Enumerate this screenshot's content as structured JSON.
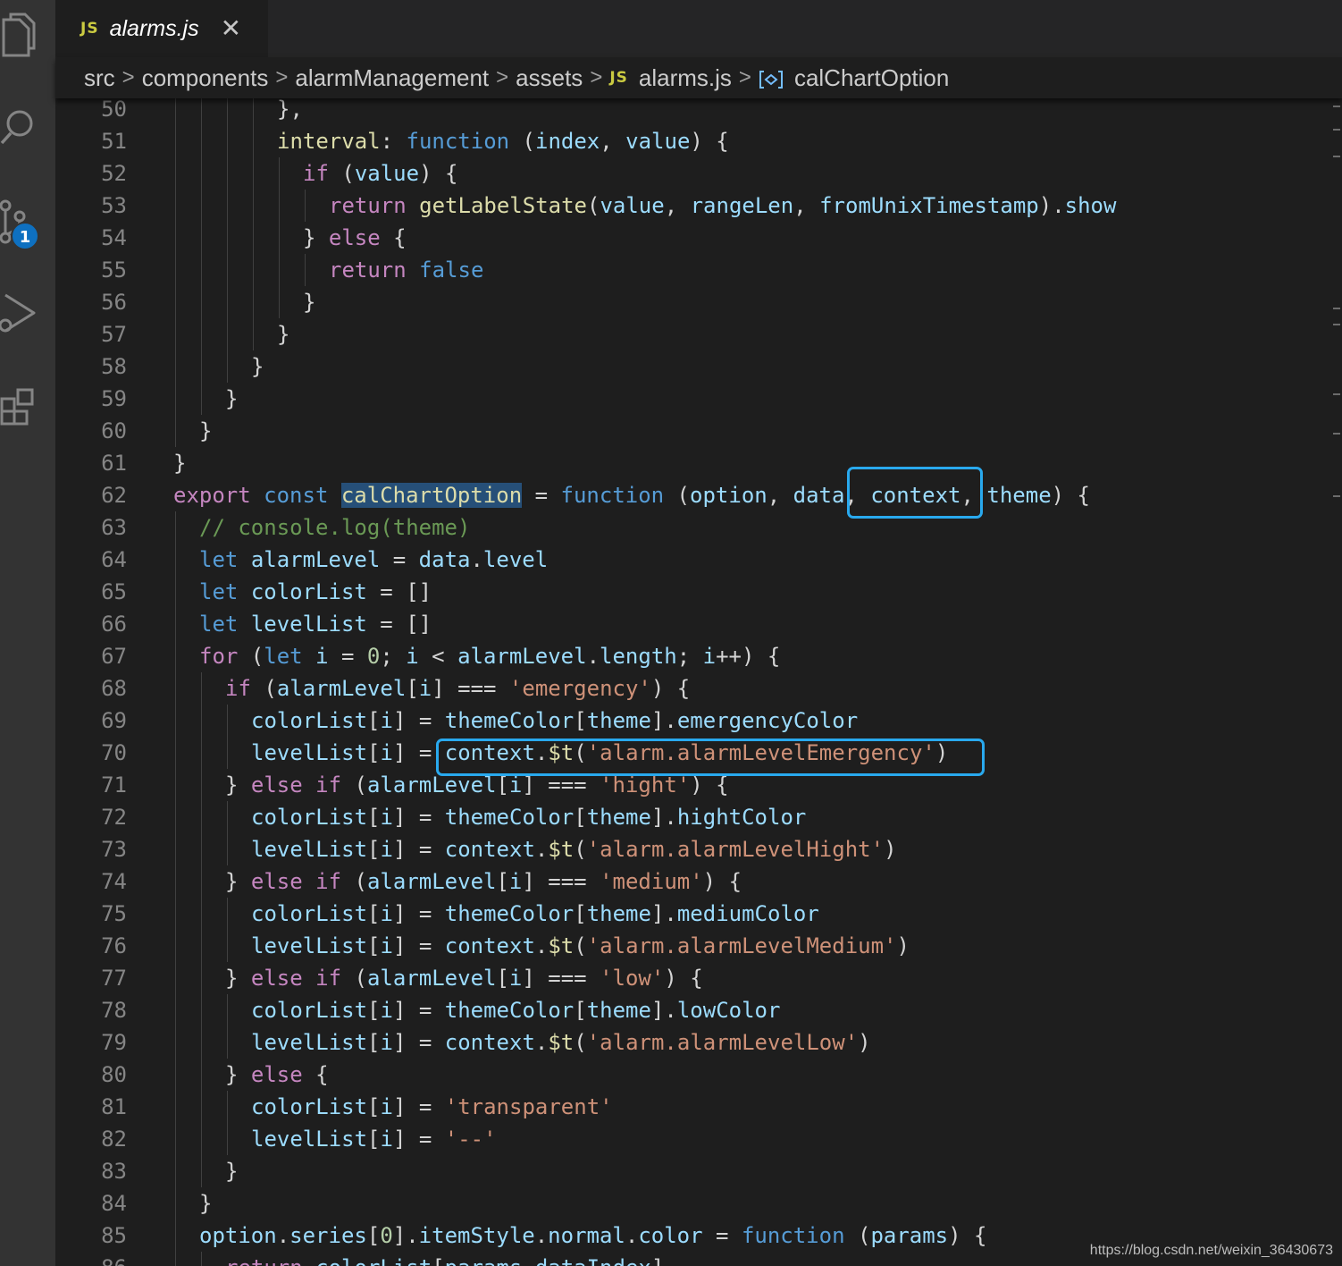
{
  "tab": {
    "lang_badge": "JS",
    "filename": "alarms.js",
    "close_glyph": "✕"
  },
  "activity_bar": {
    "icons": [
      "files-icon",
      "search-icon",
      "source-control-icon",
      "run-debug-icon",
      "extensions-icon"
    ],
    "source_control_badge": "1"
  },
  "breadcrumb": {
    "items": [
      "src",
      "components",
      "alarmManagement",
      "assets",
      "alarms.js",
      "calChartOption"
    ],
    "separator": ">",
    "file_badge": "JS"
  },
  "colors": {
    "keyword": "#c586c0",
    "storage": "#569cd6",
    "variable": "#9cdcfe",
    "function": "#dcdcaa",
    "string": "#ce9178",
    "number": "#b5cea8",
    "comment": "#6a9955",
    "highlight_box": "#29a9ee"
  },
  "code": {
    "lines": [
      {
        "n": "50",
        "indent": 4,
        "tokens": [
          [
            "p",
            "},"
          ]
        ]
      },
      {
        "n": "51",
        "indent": 4,
        "tokens": [
          [
            "f",
            "interval"
          ],
          [
            "p",
            ": "
          ],
          [
            "s",
            "function"
          ],
          [
            "p",
            " ("
          ],
          [
            "v",
            "index"
          ],
          [
            "p",
            ", "
          ],
          [
            "v",
            "value"
          ],
          [
            "p",
            ") {"
          ]
        ]
      },
      {
        "n": "52",
        "indent": 5,
        "tokens": [
          [
            "k",
            "if"
          ],
          [
            "p",
            " ("
          ],
          [
            "v",
            "value"
          ],
          [
            "p",
            ") {"
          ]
        ]
      },
      {
        "n": "53",
        "indent": 6,
        "tokens": [
          [
            "k",
            "return"
          ],
          [
            "p",
            " "
          ],
          [
            "f",
            "getLabelState"
          ],
          [
            "p",
            "("
          ],
          [
            "v",
            "value"
          ],
          [
            "p",
            ", "
          ],
          [
            "v",
            "rangeLen"
          ],
          [
            "p",
            ", "
          ],
          [
            "v",
            "fromUnixTimestamp"
          ],
          [
            "p",
            ")."
          ],
          [
            "v",
            "show"
          ]
        ]
      },
      {
        "n": "54",
        "indent": 5,
        "tokens": [
          [
            "p",
            "} "
          ],
          [
            "k",
            "else"
          ],
          [
            "p",
            " {"
          ]
        ]
      },
      {
        "n": "55",
        "indent": 6,
        "tokens": [
          [
            "k",
            "return"
          ],
          [
            "p",
            " "
          ],
          [
            "s",
            "false"
          ]
        ]
      },
      {
        "n": "56",
        "indent": 5,
        "tokens": [
          [
            "p",
            "}"
          ]
        ]
      },
      {
        "n": "57",
        "indent": 4,
        "tokens": [
          [
            "p",
            "}"
          ]
        ]
      },
      {
        "n": "58",
        "indent": 3,
        "tokens": [
          [
            "p",
            "}"
          ]
        ]
      },
      {
        "n": "59",
        "indent": 2,
        "tokens": [
          [
            "p",
            "}"
          ]
        ]
      },
      {
        "n": "60",
        "indent": 1,
        "tokens": [
          [
            "p",
            "}"
          ]
        ]
      },
      {
        "n": "61",
        "indent": 0,
        "tokens": [
          [
            "p",
            "}"
          ]
        ]
      },
      {
        "n": "62",
        "indent": 0,
        "tokens": [
          [
            "k",
            "export"
          ],
          [
            "p",
            " "
          ],
          [
            "s",
            "const"
          ],
          [
            "p",
            " "
          ],
          [
            "f hl",
            "calChartOption"
          ],
          [
            "p",
            " = "
          ],
          [
            "s",
            "function"
          ],
          [
            "p",
            " ("
          ],
          [
            "v",
            "option"
          ],
          [
            "p",
            ", "
          ],
          [
            "v",
            "data"
          ],
          [
            "p",
            ", "
          ],
          [
            "v",
            "context"
          ],
          [
            "p",
            ", "
          ],
          [
            "v",
            "theme"
          ],
          [
            "p",
            ") {"
          ]
        ]
      },
      {
        "n": "63",
        "indent": 1,
        "tokens": [
          [
            "c",
            "// console.log(theme)"
          ]
        ]
      },
      {
        "n": "64",
        "indent": 1,
        "tokens": [
          [
            "s",
            "let"
          ],
          [
            "p",
            " "
          ],
          [
            "v",
            "alarmLevel"
          ],
          [
            "p",
            " = "
          ],
          [
            "v",
            "data"
          ],
          [
            "p",
            "."
          ],
          [
            "v",
            "level"
          ]
        ]
      },
      {
        "n": "65",
        "indent": 1,
        "tokens": [
          [
            "s",
            "let"
          ],
          [
            "p",
            " "
          ],
          [
            "v",
            "colorList"
          ],
          [
            "p",
            " = []"
          ]
        ]
      },
      {
        "n": "66",
        "indent": 1,
        "tokens": [
          [
            "s",
            "let"
          ],
          [
            "p",
            " "
          ],
          [
            "v",
            "levelList"
          ],
          [
            "p",
            " = []"
          ]
        ]
      },
      {
        "n": "67",
        "indent": 1,
        "tokens": [
          [
            "k",
            "for"
          ],
          [
            "p",
            " ("
          ],
          [
            "s",
            "let"
          ],
          [
            "p",
            " "
          ],
          [
            "v",
            "i"
          ],
          [
            "p",
            " = "
          ],
          [
            "n",
            "0"
          ],
          [
            "p",
            "; "
          ],
          [
            "v",
            "i"
          ],
          [
            "p",
            " < "
          ],
          [
            "v",
            "alarmLevel"
          ],
          [
            "p",
            "."
          ],
          [
            "v",
            "length"
          ],
          [
            "p",
            "; "
          ],
          [
            "v",
            "i"
          ],
          [
            "p",
            "++) {"
          ]
        ]
      },
      {
        "n": "68",
        "indent": 2,
        "tokens": [
          [
            "k",
            "if"
          ],
          [
            "p",
            " ("
          ],
          [
            "v",
            "alarmLevel"
          ],
          [
            "p",
            "["
          ],
          [
            "v",
            "i"
          ],
          [
            "p",
            "] === "
          ],
          [
            "st",
            "'emergency'"
          ],
          [
            "p",
            ") {"
          ]
        ]
      },
      {
        "n": "69",
        "indent": 3,
        "tokens": [
          [
            "v",
            "colorList"
          ],
          [
            "p",
            "["
          ],
          [
            "v",
            "i"
          ],
          [
            "p",
            "] = "
          ],
          [
            "v",
            "themeColor"
          ],
          [
            "p",
            "["
          ],
          [
            "v",
            "theme"
          ],
          [
            "p",
            "]."
          ],
          [
            "v",
            "emergencyColor"
          ]
        ]
      },
      {
        "n": "70",
        "indent": 3,
        "tokens": [
          [
            "v",
            "levelList"
          ],
          [
            "p",
            "["
          ],
          [
            "v",
            "i"
          ],
          [
            "p",
            "] = "
          ],
          [
            "v",
            "context"
          ],
          [
            "p",
            "."
          ],
          [
            "f",
            "$t"
          ],
          [
            "p",
            "("
          ],
          [
            "st",
            "'alarm.alarmLevelEmergency'"
          ],
          [
            "p",
            ")"
          ]
        ]
      },
      {
        "n": "71",
        "indent": 2,
        "tokens": [
          [
            "p",
            "} "
          ],
          [
            "k",
            "else"
          ],
          [
            "p",
            " "
          ],
          [
            "k",
            "if"
          ],
          [
            "p",
            " ("
          ],
          [
            "v",
            "alarmLevel"
          ],
          [
            "p",
            "["
          ],
          [
            "v",
            "i"
          ],
          [
            "p",
            "] === "
          ],
          [
            "st",
            "'hight'"
          ],
          [
            "p",
            ") {"
          ]
        ]
      },
      {
        "n": "72",
        "indent": 3,
        "tokens": [
          [
            "v",
            "colorList"
          ],
          [
            "p",
            "["
          ],
          [
            "v",
            "i"
          ],
          [
            "p",
            "] = "
          ],
          [
            "v",
            "themeColor"
          ],
          [
            "p",
            "["
          ],
          [
            "v",
            "theme"
          ],
          [
            "p",
            "]."
          ],
          [
            "v",
            "hightColor"
          ]
        ]
      },
      {
        "n": "73",
        "indent": 3,
        "tokens": [
          [
            "v",
            "levelList"
          ],
          [
            "p",
            "["
          ],
          [
            "v",
            "i"
          ],
          [
            "p",
            "] = "
          ],
          [
            "v",
            "context"
          ],
          [
            "p",
            "."
          ],
          [
            "f",
            "$t"
          ],
          [
            "p",
            "("
          ],
          [
            "st",
            "'alarm.alarmLevelHight'"
          ],
          [
            "p",
            ")"
          ]
        ]
      },
      {
        "n": "74",
        "indent": 2,
        "tokens": [
          [
            "p",
            "} "
          ],
          [
            "k",
            "else"
          ],
          [
            "p",
            " "
          ],
          [
            "k",
            "if"
          ],
          [
            "p",
            " ("
          ],
          [
            "v",
            "alarmLevel"
          ],
          [
            "p",
            "["
          ],
          [
            "v",
            "i"
          ],
          [
            "p",
            "] === "
          ],
          [
            "st",
            "'medium'"
          ],
          [
            "p",
            ") {"
          ]
        ]
      },
      {
        "n": "75",
        "indent": 3,
        "tokens": [
          [
            "v",
            "colorList"
          ],
          [
            "p",
            "["
          ],
          [
            "v",
            "i"
          ],
          [
            "p",
            "] = "
          ],
          [
            "v",
            "themeColor"
          ],
          [
            "p",
            "["
          ],
          [
            "v",
            "theme"
          ],
          [
            "p",
            "]."
          ],
          [
            "v",
            "mediumColor"
          ]
        ]
      },
      {
        "n": "76",
        "indent": 3,
        "tokens": [
          [
            "v",
            "levelList"
          ],
          [
            "p",
            "["
          ],
          [
            "v",
            "i"
          ],
          [
            "p",
            "] = "
          ],
          [
            "v",
            "context"
          ],
          [
            "p",
            "."
          ],
          [
            "f",
            "$t"
          ],
          [
            "p",
            "("
          ],
          [
            "st",
            "'alarm.alarmLevelMedium'"
          ],
          [
            "p",
            ")"
          ]
        ]
      },
      {
        "n": "77",
        "indent": 2,
        "tokens": [
          [
            "p",
            "} "
          ],
          [
            "k",
            "else"
          ],
          [
            "p",
            " "
          ],
          [
            "k",
            "if"
          ],
          [
            "p",
            " ("
          ],
          [
            "v",
            "alarmLevel"
          ],
          [
            "p",
            "["
          ],
          [
            "v",
            "i"
          ],
          [
            "p",
            "] === "
          ],
          [
            "st",
            "'low'"
          ],
          [
            "p",
            ") {"
          ]
        ]
      },
      {
        "n": "78",
        "indent": 3,
        "tokens": [
          [
            "v",
            "colorList"
          ],
          [
            "p",
            "["
          ],
          [
            "v",
            "i"
          ],
          [
            "p",
            "] = "
          ],
          [
            "v",
            "themeColor"
          ],
          [
            "p",
            "["
          ],
          [
            "v",
            "theme"
          ],
          [
            "p",
            "]."
          ],
          [
            "v",
            "lowColor"
          ]
        ]
      },
      {
        "n": "79",
        "indent": 3,
        "tokens": [
          [
            "v",
            "levelList"
          ],
          [
            "p",
            "["
          ],
          [
            "v",
            "i"
          ],
          [
            "p",
            "] = "
          ],
          [
            "v",
            "context"
          ],
          [
            "p",
            "."
          ],
          [
            "f",
            "$t"
          ],
          [
            "p",
            "("
          ],
          [
            "st",
            "'alarm.alarmLevelLow'"
          ],
          [
            "p",
            ")"
          ]
        ]
      },
      {
        "n": "80",
        "indent": 2,
        "tokens": [
          [
            "p",
            "} "
          ],
          [
            "k",
            "else"
          ],
          [
            "p",
            " {"
          ]
        ]
      },
      {
        "n": "81",
        "indent": 3,
        "tokens": [
          [
            "v",
            "colorList"
          ],
          [
            "p",
            "["
          ],
          [
            "v",
            "i"
          ],
          [
            "p",
            "] = "
          ],
          [
            "st",
            "'transparent'"
          ]
        ]
      },
      {
        "n": "82",
        "indent": 3,
        "tokens": [
          [
            "v",
            "levelList"
          ],
          [
            "p",
            "["
          ],
          [
            "v",
            "i"
          ],
          [
            "p",
            "] = "
          ],
          [
            "st",
            "'--'"
          ]
        ]
      },
      {
        "n": "83",
        "indent": 2,
        "tokens": [
          [
            "p",
            "}"
          ]
        ]
      },
      {
        "n": "84",
        "indent": 1,
        "tokens": [
          [
            "p",
            "}"
          ]
        ]
      },
      {
        "n": "85",
        "indent": 1,
        "tokens": [
          [
            "v",
            "option"
          ],
          [
            "p",
            "."
          ],
          [
            "v",
            "series"
          ],
          [
            "p",
            "["
          ],
          [
            "n",
            "0"
          ],
          [
            "p",
            "]."
          ],
          [
            "v",
            "itemStyle"
          ],
          [
            "p",
            "."
          ],
          [
            "v",
            "normal"
          ],
          [
            "p",
            "."
          ],
          [
            "v",
            "color"
          ],
          [
            "p",
            " = "
          ],
          [
            "s",
            "function"
          ],
          [
            "p",
            " ("
          ],
          [
            "v",
            "params"
          ],
          [
            "p",
            ") {"
          ]
        ]
      },
      {
        "n": "86",
        "indent": 2,
        "tokens": [
          [
            "k",
            "return"
          ],
          [
            "p",
            " "
          ],
          [
            "v",
            "colorList"
          ],
          [
            "p",
            "["
          ],
          [
            "v",
            "params"
          ],
          [
            "p",
            "."
          ],
          [
            "v",
            "dataIndex"
          ],
          [
            "p",
            "]"
          ]
        ]
      }
    ]
  },
  "watermark": "https://blog.csdn.net/weixin_36430673"
}
